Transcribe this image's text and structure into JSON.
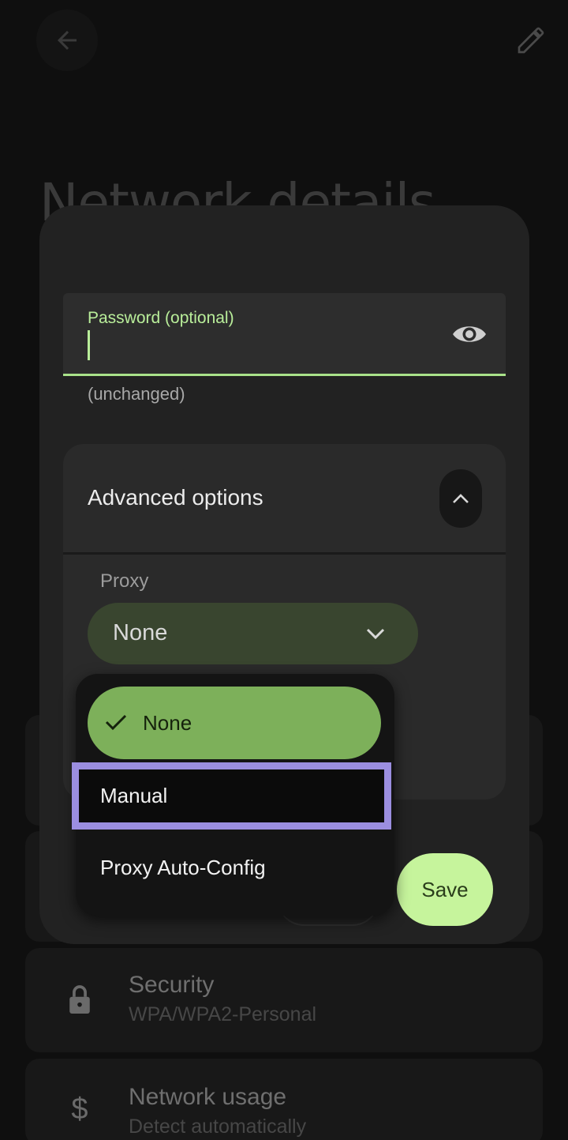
{
  "background": {
    "title": "Network details",
    "rows": [
      {
        "title": "Security",
        "subtitle": "WPA/WPA2-Personal",
        "icon": "lock-icon"
      },
      {
        "title": "Network usage",
        "subtitle": "Detect automatically",
        "icon": "dollar-icon"
      }
    ]
  },
  "dialog": {
    "password": {
      "label": "Password (optional)",
      "value": "",
      "helper": "(unchanged)"
    },
    "advanced": {
      "title": "Advanced options",
      "proxy_label": "Proxy",
      "proxy_value": "None"
    },
    "save_label": "Save"
  },
  "menu": {
    "options": [
      {
        "label": "None",
        "selected": true
      },
      {
        "label": "Manual",
        "highlighted": true
      },
      {
        "label": "Proxy Auto-Config"
      }
    ]
  },
  "colors": {
    "accent": "#a9e28a",
    "selected_option": "#7db05a",
    "highlight_outline": "#9b8ee0",
    "save_button": "#c6f49c"
  }
}
